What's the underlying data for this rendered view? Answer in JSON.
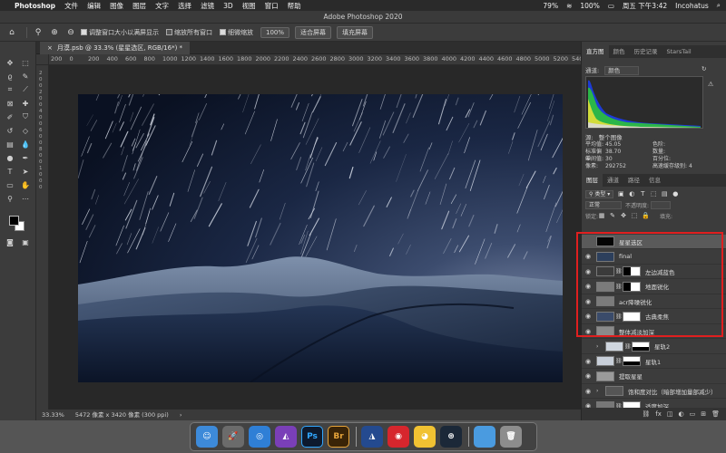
{
  "menubar": {
    "app_name": "Photoshop",
    "items": [
      "文件",
      "编辑",
      "图像",
      "图层",
      "文字",
      "选择",
      "滤镜",
      "3D",
      "视图",
      "窗口",
      "帮助"
    ],
    "battery_pct": "79%",
    "wifi_pct": "100%",
    "clock": "周五 下午3:42",
    "user": "Incohatus"
  },
  "window": {
    "title": "Adobe Photoshop 2020"
  },
  "options_bar": {
    "check1_label": "调整窗口大小以满屏显示",
    "check2_label": "缩放所有窗口",
    "check3_label": "细微缩放",
    "zoom_value": "100%",
    "fit_screen": "适合屏幕",
    "fill_screen": "填充屏幕"
  },
  "document": {
    "tab_title": "月漠.psb @ 33.3% (星星选区, RGB/16*) *",
    "zoom": "33.33%",
    "info": "5472 像素 x 3420 像素 (300 ppi)"
  },
  "ruler_h": [
    "200",
    "0",
    "200",
    "400",
    "600",
    "800",
    "1000",
    "1200",
    "1400",
    "1600",
    "1800",
    "2000",
    "2200",
    "2400",
    "2600",
    "2800",
    "3000",
    "3200",
    "3400",
    "3600",
    "3800",
    "4000",
    "4200",
    "4400",
    "4600",
    "4800",
    "5000",
    "5200",
    "5400",
    "5600"
  ],
  "ruler_v": [
    "2",
    "0",
    "0",
    "2",
    "0",
    "0",
    "4",
    "0",
    "0",
    "6",
    "0",
    "0",
    "8",
    "0",
    "0",
    "1",
    "0",
    "0",
    "0"
  ],
  "histogram_panel": {
    "tabs": [
      "直方图",
      "颜色",
      "历史记录",
      "StarsTail"
    ],
    "channel_label": "通道:",
    "channel_value": "颜色",
    "source_label": "源:",
    "source_value": "整个图像",
    "stats": [
      {
        "k": "平均值:",
        "v": "45.05",
        "k2": "色阶:",
        "v2": ""
      },
      {
        "k": "标准偏差:",
        "v": "38.70",
        "k2": "数量:",
        "v2": ""
      },
      {
        "k": "中间值:",
        "v": "30",
        "k2": "百分位:",
        "v2": ""
      },
      {
        "k": "像素:",
        "v": "292752",
        "k2": "高速缓存级别:",
        "v2": "4"
      }
    ]
  },
  "layers_panel": {
    "tabs": [
      "图层",
      "通道",
      "路径",
      "信息"
    ],
    "filter_label": "类型",
    "blend_mode": "正常",
    "opacity_label": "不透明度:",
    "lock_label": "锁定:",
    "fill_label": "填充:",
    "layers": [
      {
        "name": "星星选区",
        "eye": false,
        "thumb": "#050505",
        "mask": false,
        "selected": true
      },
      {
        "name": "final",
        "eye": true,
        "thumb": "#2c3f5c",
        "mask": false,
        "selected": false
      },
      {
        "name": "左边减蓝色",
        "eye": true,
        "thumb": "#3b3b3b",
        "mask": true,
        "adj": true,
        "selected": false
      },
      {
        "name": "地面锐化",
        "eye": true,
        "thumb": "#7b7b7b",
        "mask": true,
        "selected": false
      },
      {
        "name": "acr降噪锐化",
        "eye": true,
        "thumb": "#7b7b7b",
        "mask": false,
        "selected": false
      },
      {
        "name": "古典柔焦",
        "eye": true,
        "thumb": "#3a4b6a",
        "mask": true,
        "selected": false
      },
      {
        "name": "整体减淡加深",
        "eye": true,
        "thumb": "#8a8a8a",
        "mask": false,
        "selected": false
      },
      {
        "name": "星轨2",
        "eye": false,
        "thumb": "#cfd6df",
        "mask": true,
        "folder": true,
        "selected": false
      },
      {
        "name": "星轨1",
        "eye": true,
        "thumb": "#c8cfd9",
        "mask": true,
        "selected": false
      },
      {
        "name": "提取星星",
        "eye": true,
        "thumb": "#9a9a9a",
        "mask": false,
        "selected": false
      },
      {
        "name": "饱和度对比（暗部增加量部减少）",
        "eye": true,
        "thumb": "#555",
        "mask": false,
        "folder": true,
        "selected": false
      },
      {
        "name": "适度加深",
        "eye": true,
        "thumb": "#777",
        "mask": true,
        "selected": false
      }
    ]
  },
  "dock": {
    "apps": [
      {
        "name": "Finder",
        "label": "☺",
        "color": "#3d8ad9"
      },
      {
        "name": "Launchpad",
        "label": "🚀",
        "color": "#6b6b6b"
      },
      {
        "name": "Safari",
        "label": "◎",
        "color": "#2f7fd6"
      },
      {
        "name": "Affinity Photo",
        "label": "◭",
        "color": "#7a3fb8"
      },
      {
        "name": "Photoshop",
        "label": "Ps",
        "color": "#0d1a2e"
      },
      {
        "name": "Bridge",
        "label": "Br",
        "color": "#3a2407"
      },
      {
        "name": "Affinity Designer",
        "label": "◮",
        "color": "#244a8f"
      },
      {
        "name": "NetEase Music",
        "label": "◉",
        "color": "#d6262d"
      },
      {
        "name": "Chrome",
        "label": "◕",
        "color": "#f1c232"
      },
      {
        "name": "Steam",
        "label": "⊛",
        "color": "#1b2838"
      },
      {
        "name": "Folder",
        "label": "",
        "color": "#4a9be0"
      },
      {
        "name": "Trash",
        "label": "🗑",
        "color": "#8d8d8d"
      }
    ]
  },
  "colors": {
    "highlight": "#e01f1f",
    "panel_bg": "#3c3c3c",
    "canvas_bg": "#282828"
  }
}
